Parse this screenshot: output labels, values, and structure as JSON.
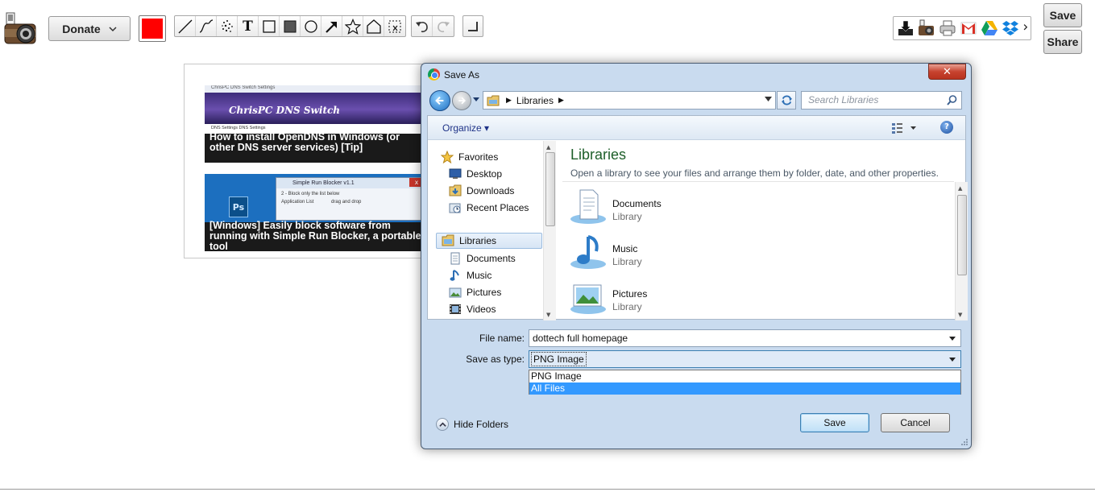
{
  "toolbar": {
    "donate_label": "Donate",
    "selected_color": "#ff0000",
    "text_tool_glyph": "T",
    "save_label": "Save",
    "share_label": "Share",
    "tools": [
      "line-icon",
      "curve-icon",
      "spray-icon",
      "text-icon",
      "rectangle-icon",
      "filled-rectangle-icon",
      "ellipse-icon",
      "arrow-icon",
      "star-icon",
      "house-shape-icon",
      "crop-icon"
    ],
    "share_targets": [
      "download-icon",
      "camera-icon",
      "printer-icon",
      "gmail-icon",
      "google-drive-icon",
      "dropbox-icon"
    ]
  },
  "preview": {
    "thumb1": {
      "window_title": "ChrisPC DNS Switch Settings",
      "brand": "ChrisPC DNS Switch",
      "links": "DNS Settings          DNS Settings",
      "caption": "How to install OpenDNS in Windows (or other DNS server services) [Tip]"
    },
    "thumb2": {
      "window_title": "Simple Run Blocker v1.1",
      "dropdown": "2 - Block only the list below",
      "list_label": "Application List",
      "drag_hint": "drag and drop",
      "caption": "[Windows] Easily block software from running with Simple Run Blocker, a portable tool"
    }
  },
  "dialog": {
    "title": "Save As",
    "close_glyph": "✕",
    "address": "Libraries",
    "search_placeholder": "Search Libraries",
    "organize_label": "Organize ▾",
    "help_glyph": "?",
    "nav": {
      "favorites": "Favorites",
      "desktop": "Desktop",
      "downloads": "Downloads",
      "recent_places": "Recent Places",
      "libraries": "Libraries",
      "documents": "Documents",
      "music": "Music",
      "pictures": "Pictures",
      "videos": "Videos"
    },
    "content": {
      "heading": "Libraries",
      "subtitle": "Open a library to see your files and arrange them by folder, date, and other properties.",
      "items": [
        {
          "name": "Documents",
          "type": "Library"
        },
        {
          "name": "Music",
          "type": "Library"
        },
        {
          "name": "Pictures",
          "type": "Library"
        }
      ]
    },
    "file_name_label": "File name:",
    "file_name_value": "dottech full homepage",
    "save_type_label": "Save as type:",
    "save_type_value": "PNG Image",
    "type_options": [
      "PNG Image",
      "All Files"
    ],
    "hide_folders_label": "Hide Folders",
    "save_button": "Save",
    "cancel_button": "Cancel"
  }
}
